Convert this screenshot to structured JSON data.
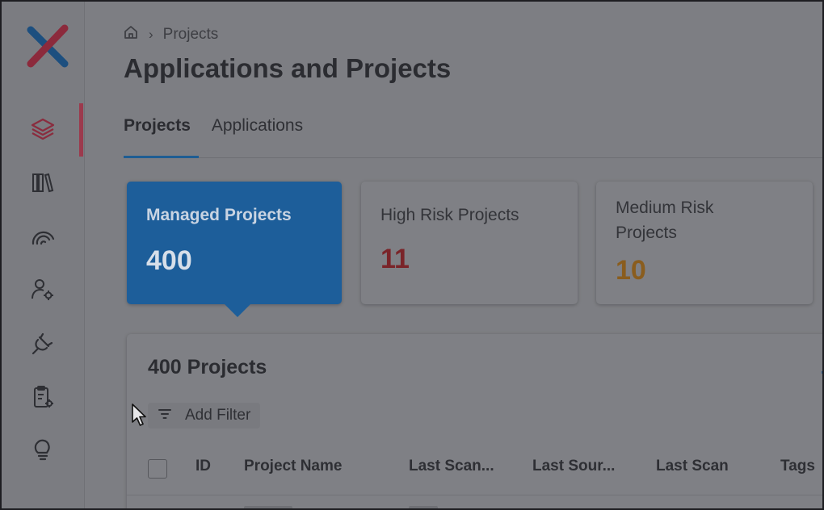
{
  "breadcrumb": {
    "current": "Projects"
  },
  "page": {
    "title": "Applications and Projects"
  },
  "tabs": [
    {
      "label": "Projects",
      "active": true
    },
    {
      "label": "Applications",
      "active": false
    }
  ],
  "summary_cards": [
    {
      "title": "Managed Projects",
      "value": "400",
      "value_color": "#d7dfe9",
      "selected": true
    },
    {
      "title": "High Risk Projects",
      "value": "11",
      "value_color": "#7a2429"
    },
    {
      "title": "Medium Risk Projects",
      "value": "10",
      "value_color": "#8a5d1e"
    }
  ],
  "projects_panel": {
    "title": "400 Projects",
    "filter_label": "Add Filter",
    "columns": [
      "ID",
      "Project Name",
      "Last Scan...",
      "Last Sour...",
      "Last Scan",
      "Tags"
    ]
  },
  "sidebar": {
    "items": [
      {
        "icon": "layers-icon",
        "active": true
      },
      {
        "icon": "library-icon"
      },
      {
        "icon": "gauge-icon"
      },
      {
        "icon": "user-settings-icon"
      },
      {
        "icon": "plug-icon"
      },
      {
        "icon": "clipboard-settings-icon"
      },
      {
        "icon": "lightbulb-icon"
      }
    ]
  },
  "colors": {
    "accent": "#1d5e9a",
    "active_indicator": "#9c3a4d"
  }
}
